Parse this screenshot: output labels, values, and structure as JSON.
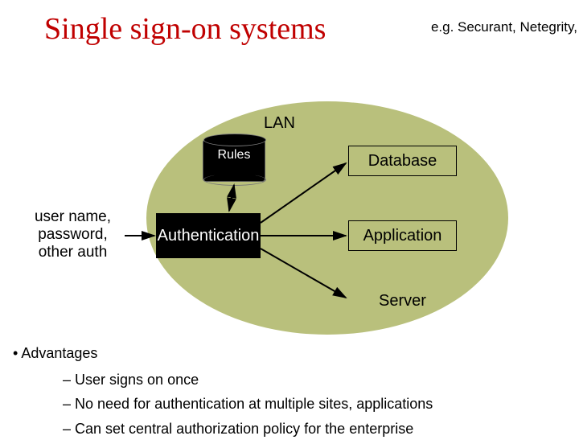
{
  "title": "Single sign-on systems",
  "subtitle": "e.g. Securant, Netegrity,",
  "diagram": {
    "lan": "LAN",
    "rules": "Rules",
    "auth": "Authentication",
    "creds_line1": "user name,",
    "creds_line2": "password,",
    "creds_line3": "other auth",
    "database": "Database",
    "application": "Application",
    "server": "Server"
  },
  "advantages_heading": "Advantages",
  "advantages": [
    "User signs on once",
    "No need for authentication at multiple sites, applications",
    "Can set central authorization policy for the enterprise"
  ]
}
